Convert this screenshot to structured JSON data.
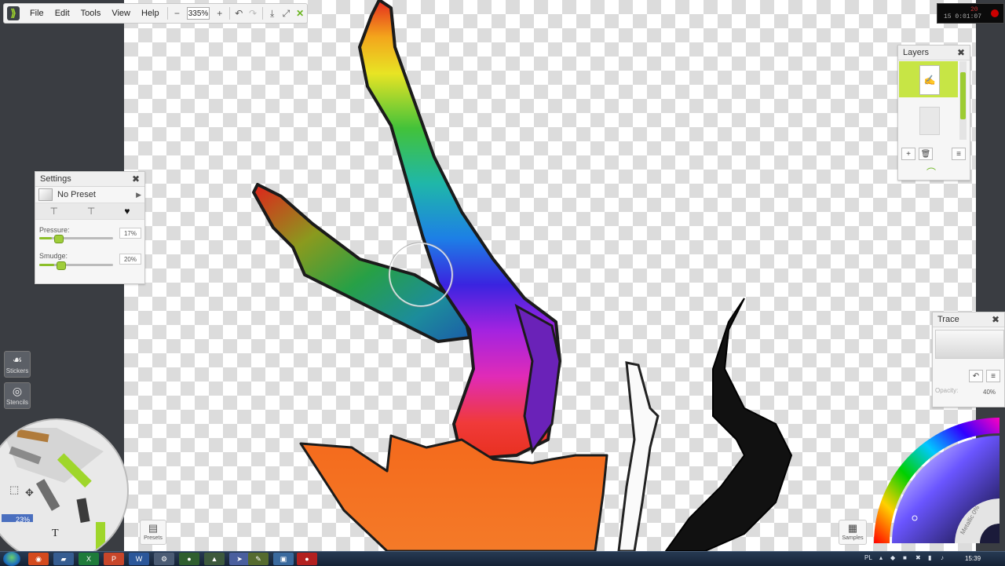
{
  "menu": {
    "items": [
      "File",
      "Edit",
      "Tools",
      "View",
      "Help"
    ],
    "zoom": "335%"
  },
  "recorder": {
    "time": "15 0:01:07",
    "size": "20"
  },
  "settings_panel": {
    "title": "Settings",
    "preset": "No Preset",
    "pressure_label": "Pressure:",
    "pressure_value": "17%",
    "pressure_level": 0.17,
    "smudge_label": "Smudge:",
    "smudge_value": "20%",
    "smudge_level": 0.2
  },
  "layers_panel": {
    "title": "Layers"
  },
  "trace_panel": {
    "title": "Trace",
    "opacity_label": "Opacity:",
    "opacity_value": "40%"
  },
  "left_tools": {
    "stickers": "Stickers",
    "stencils": "Stencils",
    "zoom": "23%"
  },
  "bottom": {
    "presets": "Presets",
    "samples": "Samples"
  },
  "color_wheel": {
    "metallic_label": "Metallic 0%",
    "accent_color": "#9fd62b"
  },
  "taskbar": {
    "clock": "15:39",
    "lang": "PL"
  }
}
